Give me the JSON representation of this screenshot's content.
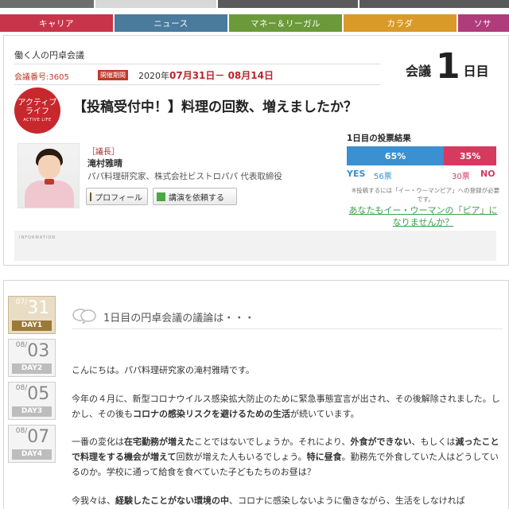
{
  "categories": [
    {
      "label": "キャリア",
      "color": "#c8344a"
    },
    {
      "label": "ニュース",
      "color": "#4a7a9c"
    },
    {
      "label": "マネー＆リーガル",
      "color": "#6c9a3a"
    },
    {
      "label": "カラダ",
      "color": "#d99a28"
    },
    {
      "label": "ソサ",
      "color": "#b03c7c"
    }
  ],
  "header": {
    "site_name": "働く人の円卓会議",
    "meeting_number": "会議番号:3605",
    "period_badge": "開催期間",
    "period_year": "2020年",
    "period_range": "07月31日－ 08月14日",
    "day_prefix": "会議",
    "day_number": "1",
    "day_suffix": "日目"
  },
  "topic": {
    "badge_line1": "アクティブ",
    "badge_line2": "ライフ",
    "badge_line3": "ACTIVE LIFE",
    "headline": "【投稿受付中！】料理の回数、増えましたか？"
  },
  "chair": {
    "role": "［議長］",
    "name": "滝村雅晴",
    "title": "パパ料理研究家、株式会社ビストロパパ 代表取締役",
    "profile_button": "プロフィール",
    "lecture_button": "講演を依頼する"
  },
  "vote": {
    "title": "1日目の投票結果",
    "yes_percent_label": "65%",
    "no_percent_label": "35%",
    "yes_fraction": 0.65,
    "yes_label": "YES",
    "yes_count": "56票",
    "no_count": "30票",
    "no_label": "NO",
    "note": "※投稿するには「イー・ウーマンピア」への登録が必要です。",
    "cta": "あなたもイー・ウーマンの「ピア」になりませんか？"
  },
  "info_label": "INFORMATION",
  "days": [
    {
      "month": "07/",
      "day": "31",
      "label": "DAY1",
      "active": true
    },
    {
      "month": "08/",
      "day": "03",
      "label": "DAY2",
      "active": false
    },
    {
      "month": "08/",
      "day": "05",
      "label": "DAY3",
      "active": false
    },
    {
      "month": "08/",
      "day": "07",
      "label": "DAY4",
      "active": false
    }
  ],
  "discussion": {
    "title": "1日目の円卓会議の議論は・・・",
    "p1": "こんにちは。パパ料理研究家の滝村雅晴です。",
    "p2a": "今年の４月に、新型コロナウイルス感染拡大防止のために緊急事態宣言が出され、その後解除されました。しかし、その後も",
    "p2b": "コロナの感染リスクを避けるための生活",
    "p2c": "が続いています。",
    "p3a": "一番の変化は",
    "p3b": "在宅勤務が増えた",
    "p3c": "ことではないでしょうか。それにより、",
    "p3d": "外食ができない",
    "p3e": "、もしくは",
    "p3f": "減ったことで料理をする機会が増えて",
    "p3g": "回数が増えた人もいるでしょう。",
    "p3h": "特に昼食",
    "p3i": "。勤務先で外食していた人はどうしているのか。学校に通って給食を食べていた子どもたちのお昼は？",
    "p4a": "今我々は、",
    "p4b": "経験したことがない環境の中",
    "p4c": "、コロナに感染しないように働きながら、生活をしなければ"
  }
}
